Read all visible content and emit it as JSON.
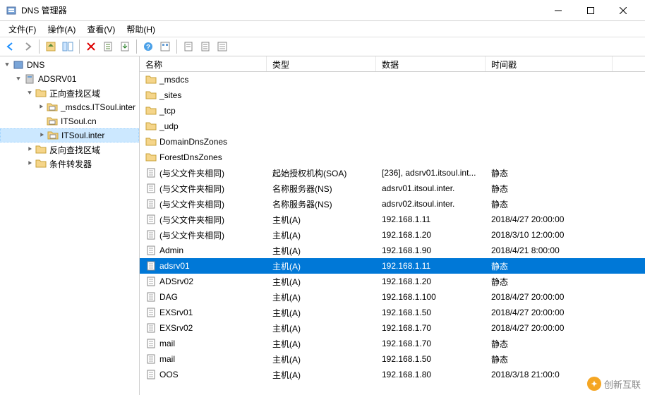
{
  "window": {
    "title": "DNS 管理器"
  },
  "menu": {
    "file": "文件(F)",
    "action": "操作(A)",
    "view": "查看(V)",
    "help": "帮助(H)"
  },
  "tree": {
    "root": "DNS",
    "server": "ADSRV01",
    "fwd_zone": "正向查找区域",
    "zones": {
      "msdcs": "_msdcs.ITSoul.inter",
      "cn": "ITSoul.cn",
      "inter": "ITSoul.inter"
    },
    "rev_zone": "反向查找区域",
    "cond_fwd": "条件转发器"
  },
  "columns": {
    "name": "名称",
    "type": "类型",
    "data": "数据",
    "timestamp": "时间戳"
  },
  "rows": [
    {
      "icon": "folder",
      "name": "_msdcs",
      "type": "",
      "data": "",
      "ts": ""
    },
    {
      "icon": "folder",
      "name": "_sites",
      "type": "",
      "data": "",
      "ts": ""
    },
    {
      "icon": "folder",
      "name": "_tcp",
      "type": "",
      "data": "",
      "ts": ""
    },
    {
      "icon": "folder",
      "name": "_udp",
      "type": "",
      "data": "",
      "ts": ""
    },
    {
      "icon": "folder",
      "name": "DomainDnsZones",
      "type": "",
      "data": "",
      "ts": ""
    },
    {
      "icon": "folder",
      "name": "ForestDnsZones",
      "type": "",
      "data": "",
      "ts": ""
    },
    {
      "icon": "record",
      "name": "(与父文件夹相同)",
      "type": "起始授权机构(SOA)",
      "data": "[236], adsrv01.itsoul.int...",
      "ts": "静态"
    },
    {
      "icon": "record",
      "name": "(与父文件夹相同)",
      "type": "名称服务器(NS)",
      "data": "adsrv01.itsoul.inter.",
      "ts": "静态"
    },
    {
      "icon": "record",
      "name": "(与父文件夹相同)",
      "type": "名称服务器(NS)",
      "data": "adsrv02.itsoul.inter.",
      "ts": "静态"
    },
    {
      "icon": "record",
      "name": "(与父文件夹相同)",
      "type": "主机(A)",
      "data": "192.168.1.11",
      "ts": "2018/4/27 20:00:00"
    },
    {
      "icon": "record",
      "name": "(与父文件夹相同)",
      "type": "主机(A)",
      "data": "192.168.1.20",
      "ts": "2018/3/10 12:00:00"
    },
    {
      "icon": "record",
      "name": "Admin",
      "type": "主机(A)",
      "data": "192.168.1.90",
      "ts": "2018/4/21 8:00:00"
    },
    {
      "icon": "record",
      "name": "adsrv01",
      "type": "主机(A)",
      "data": "192.168.1.11",
      "ts": "静态",
      "selected": true
    },
    {
      "icon": "record",
      "name": "ADSrv02",
      "type": "主机(A)",
      "data": "192.168.1.20",
      "ts": "静态"
    },
    {
      "icon": "record",
      "name": "DAG",
      "type": "主机(A)",
      "data": "192.168.1.100",
      "ts": "2018/4/27 20:00:00"
    },
    {
      "icon": "record",
      "name": "EXSrv01",
      "type": "主机(A)",
      "data": "192.168.1.50",
      "ts": "2018/4/27 20:00:00"
    },
    {
      "icon": "record",
      "name": "EXSrv02",
      "type": "主机(A)",
      "data": "192.168.1.70",
      "ts": "2018/4/27 20:00:00"
    },
    {
      "icon": "record",
      "name": "mail",
      "type": "主机(A)",
      "data": "192.168.1.70",
      "ts": "静态"
    },
    {
      "icon": "record",
      "name": "mail",
      "type": "主机(A)",
      "data": "192.168.1.50",
      "ts": "静态"
    },
    {
      "icon": "record",
      "name": "OOS",
      "type": "主机(A)",
      "data": "192.168.1.80",
      "ts": "2018/3/18 21:00:0"
    }
  ],
  "watermark": "创新互联"
}
